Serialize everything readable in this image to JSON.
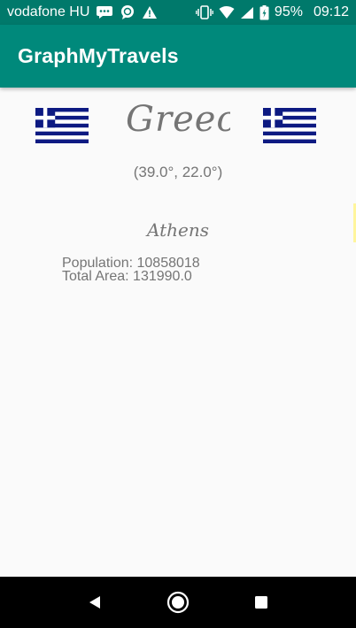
{
  "status_bar": {
    "carrier": "vodafone HU",
    "battery": "95%",
    "time": "09:12"
  },
  "app_bar": {
    "title": "GraphMyTravels"
  },
  "country": {
    "name": "Greece",
    "coordinates": "(39.0°, 22.0°)",
    "capital": "Athens",
    "population_text": "Population: 10858018",
    "area_text": "Total Area: 131990.0",
    "flag_colors": {
      "blue": "#0d1a82",
      "white": "#ffffff"
    }
  },
  "colors": {
    "primary": "#00897b",
    "primary_dark": "#00796b",
    "text_secondary": "#757575"
  }
}
